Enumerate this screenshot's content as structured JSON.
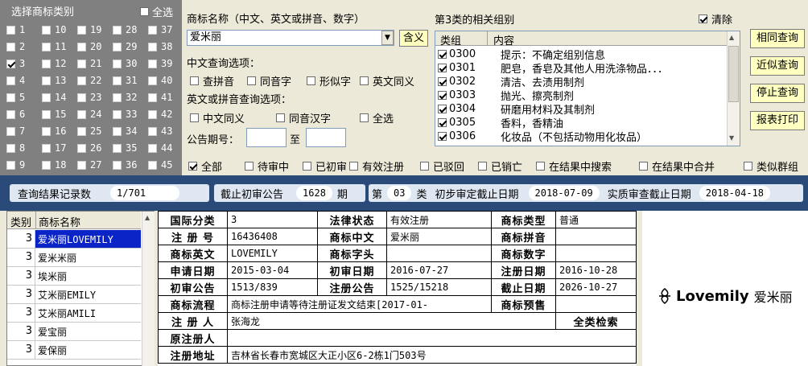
{
  "class_panel": {
    "title": "选择商标类别",
    "select_all": "全选",
    "columns": [
      [
        {
          "n": "1",
          "on": false
        },
        {
          "n": "2",
          "on": false
        },
        {
          "n": "3",
          "on": true
        },
        {
          "n": "4",
          "on": false
        },
        {
          "n": "5",
          "on": false
        },
        {
          "n": "6",
          "on": false
        },
        {
          "n": "7",
          "on": false
        },
        {
          "n": "8",
          "on": false
        },
        {
          "n": "9",
          "on": false
        }
      ],
      [
        {
          "n": "10",
          "on": false
        },
        {
          "n": "11",
          "on": false
        },
        {
          "n": "12",
          "on": false
        },
        {
          "n": "13",
          "on": false
        },
        {
          "n": "14",
          "on": false
        },
        {
          "n": "15",
          "on": false
        },
        {
          "n": "16",
          "on": false
        },
        {
          "n": "17",
          "on": false
        },
        {
          "n": "18",
          "on": false
        }
      ],
      [
        {
          "n": "19",
          "on": false
        },
        {
          "n": "20",
          "on": false
        },
        {
          "n": "21",
          "on": false
        },
        {
          "n": "22",
          "on": false
        },
        {
          "n": "23",
          "on": false
        },
        {
          "n": "24",
          "on": false
        },
        {
          "n": "25",
          "on": false
        },
        {
          "n": "26",
          "on": false
        },
        {
          "n": "27",
          "on": false
        }
      ],
      [
        {
          "n": "28",
          "on": false
        },
        {
          "n": "29",
          "on": false
        },
        {
          "n": "30",
          "on": false
        },
        {
          "n": "31",
          "on": false
        },
        {
          "n": "32",
          "on": false
        },
        {
          "n": "33",
          "on": false
        },
        {
          "n": "34",
          "on": false
        },
        {
          "n": "35",
          "on": false
        },
        {
          "n": "36",
          "on": false
        }
      ],
      [
        {
          "n": "37",
          "on": false
        },
        {
          "n": "38",
          "on": false
        },
        {
          "n": "39",
          "on": false
        },
        {
          "n": "40",
          "on": false
        },
        {
          "n": "41",
          "on": false
        },
        {
          "n": "42",
          "on": false
        },
        {
          "n": "43",
          "on": false
        },
        {
          "n": "44",
          "on": false
        },
        {
          "n": "45",
          "on": false
        }
      ]
    ]
  },
  "search": {
    "name_label": "商标名称（中文、英文或拼音、数字）",
    "name_value": "爱米丽",
    "meaning_button": "含义",
    "cn_options_label": "中文查询选项：",
    "cn_options": [
      "查拼音",
      "同音字",
      "形似字",
      "英文同义"
    ],
    "en_options_label": "英文或拼音查询选项：",
    "en_options": [
      "中文同义",
      "同音汉字",
      "全选"
    ],
    "issue_label": "公告期号：",
    "issue_to": "至"
  },
  "groups": {
    "label": "第3类的相关组别",
    "clear_label": "清除",
    "clear_checked": true,
    "col_group": "类组",
    "col_content": "内容",
    "rows": [
      {
        "code": "0300",
        "desc": "提示：不确定组别信息"
      },
      {
        "code": "0301",
        "desc": "肥皂，香皂及其他人用洗涤物品．．．"
      },
      {
        "code": "0302",
        "desc": "清洁、去渍用制剂"
      },
      {
        "code": "0303",
        "desc": "抛光、擦亮制剂"
      },
      {
        "code": "0304",
        "desc": "研磨用材料及其制剂"
      },
      {
        "code": "0305",
        "desc": "香料，香精油"
      },
      {
        "code": "0306",
        "desc": "化妆品（不包括动物用化妆品）"
      }
    ]
  },
  "buttons": [
    "相同查询",
    "近似查询",
    "停止查询",
    "报表打印"
  ],
  "filters": [
    {
      "label": "全部",
      "on": true
    },
    {
      "label": "待审中",
      "on": false
    },
    {
      "label": "已初审",
      "on": false
    },
    {
      "label": "有效注册",
      "on": false
    },
    {
      "label": "已驳回",
      "on": false
    },
    {
      "label": "已销亡",
      "on": false
    },
    {
      "label": "在结果中搜索",
      "on": false
    },
    {
      "label": "在结果中合并",
      "on": false
    },
    {
      "label": "类似群组",
      "on": false
    }
  ],
  "status_bar": {
    "records_label": "查询结果记录数",
    "records_value": "1/701",
    "cutoff_label": "截止初审公告",
    "cutoff_value": "1628",
    "period_unit": "期",
    "class_prefix": "第",
    "class_value": "03",
    "class_suffix": "类",
    "prelim_label": "初步审定截止日期",
    "prelim_value": "2018-07-09",
    "substantive_label": "实质审查截止日期",
    "substantive_value": "2018-04-18"
  },
  "results": {
    "col_class": "类别",
    "col_name": "商标名称",
    "rows": [
      {
        "cls": "3",
        "name": "爱米丽LOVEMILY",
        "selected": true
      },
      {
        "cls": "3",
        "name": "爱米米丽",
        "selected": false
      },
      {
        "cls": "3",
        "name": "埃米丽",
        "selected": false
      },
      {
        "cls": "3",
        "name": "艾米丽EMILY",
        "selected": false
      },
      {
        "cls": "3",
        "name": "艾米丽AMILI",
        "selected": false
      },
      {
        "cls": "3",
        "name": "爱宝丽",
        "selected": false
      },
      {
        "cls": "3",
        "name": "爱保丽",
        "selected": false
      }
    ]
  },
  "detail": {
    "intl_class_k": "国际分类",
    "intl_class_v": "3",
    "legal_status_k": "法律状态",
    "legal_status_v": "有效注册",
    "tm_type_k": "商标类型",
    "tm_type_v": "普通",
    "reg_no_k": "注 册 号",
    "reg_no_v": "16436408",
    "tm_cn_k": "商标中文",
    "tm_cn_v": "爱米丽",
    "tm_pinyin_k": "商标拼音",
    "tm_pinyin_v": "",
    "tm_en_k": "商标英文",
    "tm_en_v": "LOVEMILY",
    "tm_head_k": "商标字头",
    "tm_head_v": "",
    "tm_digit_k": "商标数字",
    "tm_digit_v": "",
    "apply_date_k": "申请日期",
    "apply_date_v": "2015-03-04",
    "prelim_date_k": "初审日期",
    "prelim_date_v": "2016-07-27",
    "reg_date_k": "注册日期",
    "reg_date_v": "2016-10-28",
    "prelim_pub_k": "初审公告",
    "prelim_pub_v": "1513/839",
    "reg_pub_k": "注册公告",
    "reg_pub_v": "1525/15218",
    "expiry_k": "截止日期",
    "expiry_v": "2026-10-27",
    "flow_k": "商标流程",
    "flow_v": "商标注册申请等待注册证发文结束[2017-01-",
    "warn_k": "商标预售",
    "warn_v": "",
    "registrant_k": "注 册 人",
    "registrant_v": "张海龙",
    "all_search": "全类检索",
    "orig_registrant_k": "原注册人",
    "orig_registrant_v": "",
    "address_k": "注册地址",
    "address_v": "吉林省长春市宽城区大正小区6-2栋1门503号"
  },
  "logo": {
    "text_en": "Lovemily",
    "text_cn": "爱米丽"
  }
}
